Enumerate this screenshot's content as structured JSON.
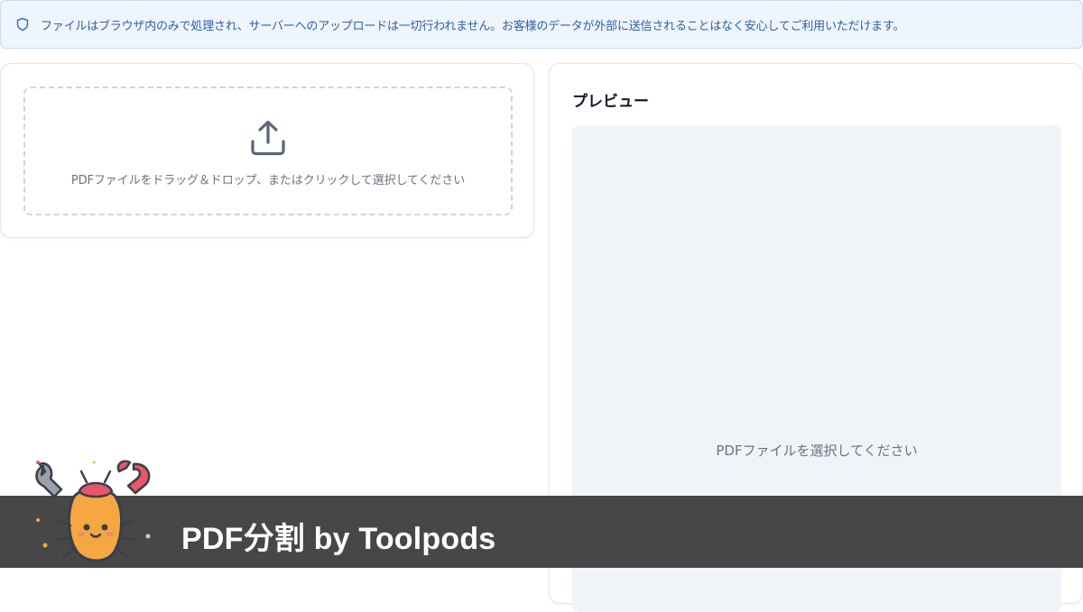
{
  "notice": {
    "icon": "shield-icon",
    "text": "ファイルはブラウザ内のみで処理され、サーバーへのアップロードは一切行われません。お客様のデータが外部に送信されることはなく安心してご利用いただけます。"
  },
  "upload": {
    "icon": "upload-icon",
    "hint": "PDFファイルをドラッグ＆ドロップ、またはクリックして選択してください"
  },
  "preview": {
    "title": "プレビュー",
    "empty_message": "PDFファイルを選択してください"
  },
  "banner": {
    "title": "PDF分割 by Toolpods",
    "mascot": "toolpods-mascot"
  },
  "colors": {
    "notice_bg": "#eef5fe",
    "notice_text": "#2f5fa8",
    "banner_bg": "#373737",
    "mascot_orange": "#f5a742",
    "mascot_claw": "#e8566b"
  }
}
